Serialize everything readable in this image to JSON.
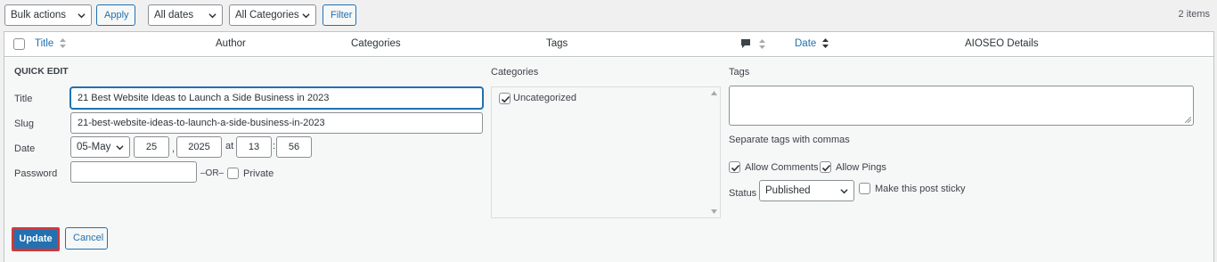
{
  "toolbar": {
    "bulk_actions": "Bulk actions",
    "apply": "Apply",
    "all_dates": "All dates",
    "all_categories": "All Categories",
    "filter": "Filter",
    "item_count": "2 items"
  },
  "columns": {
    "title": "Title",
    "author": "Author",
    "categories": "Categories",
    "tags": "Tags",
    "date": "Date",
    "aioseo": "AIOSEO Details"
  },
  "quick_edit": {
    "heading": "QUICK EDIT",
    "title_label": "Title",
    "title_value": "21 Best Website Ideas to Launch a Side Business in 2023",
    "slug_label": "Slug",
    "slug_value": "21-best-website-ideas-to-launch-a-side-business-in-2023",
    "date_label": "Date",
    "month": "05-May",
    "day": "25",
    "year": "2025",
    "at": "at",
    "hour": "13",
    "colon": ":",
    "comma": ",",
    "minute": "56",
    "password_label": "Password",
    "or_text": "–OR–",
    "private_label": "Private",
    "categories_label": "Categories",
    "category_item": "Uncategorized",
    "tags_label": "Tags",
    "tags_hint": "Separate tags with commas",
    "allow_comments": "Allow Comments",
    "allow_pings": "Allow Pings",
    "status_label": "Status",
    "status_value": "Published",
    "sticky_label": "Make this post sticky",
    "update": "Update",
    "cancel": "Cancel"
  }
}
